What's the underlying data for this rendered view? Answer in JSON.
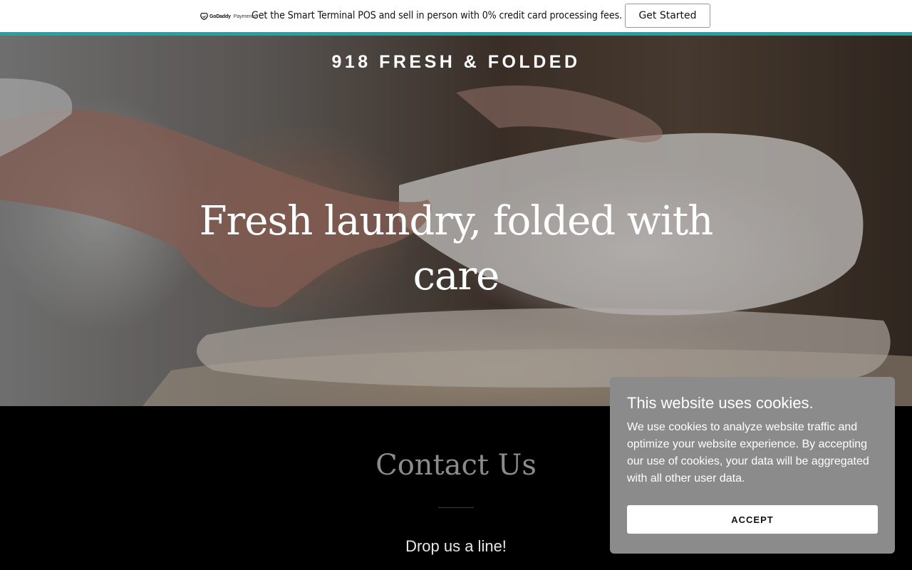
{
  "promo": {
    "logo_brand": "GoDaddy",
    "logo_sub": "Payments",
    "logo_icon": "godaddy-logo-icon",
    "text": "Get the Smart Terminal POS and sell in person with 0% credit card processing fees.",
    "button_label": "Get Started",
    "accent_color": "#1ba6a6"
  },
  "hero": {
    "site_title": "918 FRESH & FOLDED",
    "heading": "Fresh laundry, folded with care"
  },
  "contact": {
    "title": "Contact Us",
    "subtitle": "Drop us a line!"
  },
  "cookie": {
    "title": "This website uses cookies.",
    "text": "We use cookies to analyze website traffic and optimize your website experience. By accepting our use of cookies, your data will be aggregated with all other user data.",
    "accept_label": "ACCEPT",
    "background_color": "#8b8b8b"
  }
}
